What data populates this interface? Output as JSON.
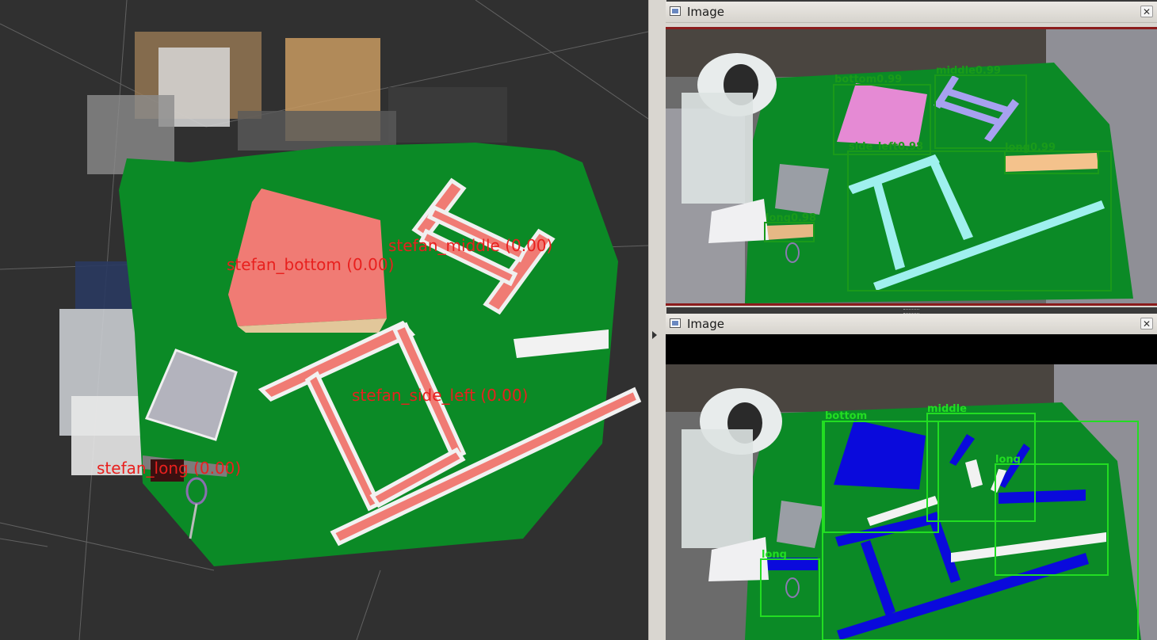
{
  "viewer3d": {
    "labels": {
      "bottom": "stefan_bottom (0.00)",
      "middle": "stefan_middle (0.00)",
      "side_left": "stefan_side_left (0.00)",
      "long": "stefan_long (0.00)"
    },
    "label_color": "#e8201e",
    "tablecloth_color": "#0b8a26"
  },
  "top_window": {
    "title": "Image",
    "close_label": "✕",
    "detections": [
      {
        "label": "bottom0.99"
      },
      {
        "label": "middle0.99"
      },
      {
        "label": "side_left0.98"
      },
      {
        "label": "long0.99"
      },
      {
        "label": "long0.98"
      }
    ],
    "box_color": "#1a9a1a"
  },
  "bottom_window": {
    "title": "Image",
    "close_label": "✕",
    "detections": [
      {
        "label": "bottom"
      },
      {
        "label": "middle"
      },
      {
        "label": "long"
      },
      {
        "label": "long"
      }
    ],
    "box_color": "#22dd22"
  }
}
